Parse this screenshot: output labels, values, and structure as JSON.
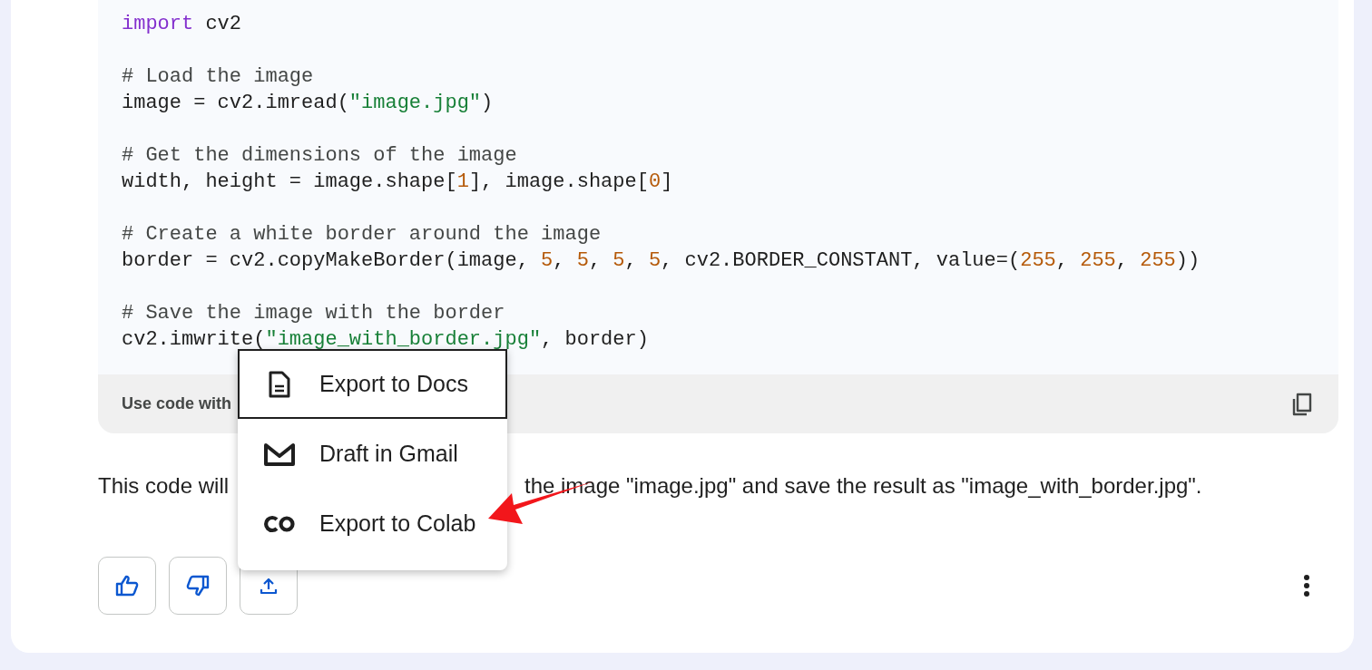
{
  "code_block": {
    "blocks": [
      [
        [
          {
            "kind": "keyword",
            "text": "import"
          },
          {
            "kind": "plain",
            "text": " cv2"
          }
        ]
      ],
      [
        [
          {
            "kind": "comment",
            "text": "# Load the image"
          }
        ],
        [
          {
            "kind": "plain",
            "text": "image = cv2.imread("
          },
          {
            "kind": "string",
            "text": "\"image.jpg\""
          },
          {
            "kind": "plain",
            "text": ")"
          }
        ]
      ],
      [
        [
          {
            "kind": "comment",
            "text": "# Get the dimensions of the image"
          }
        ],
        [
          {
            "kind": "plain",
            "text": "width, height = image.shape["
          },
          {
            "kind": "number",
            "text": "1"
          },
          {
            "kind": "plain",
            "text": "], image.shape["
          },
          {
            "kind": "number",
            "text": "0"
          },
          {
            "kind": "plain",
            "text": "]"
          }
        ]
      ],
      [
        [
          {
            "kind": "comment",
            "text": "# Create a white border around the image"
          }
        ],
        [
          {
            "kind": "plain",
            "text": "border = cv2.copyMakeBorder(image, "
          },
          {
            "kind": "number",
            "text": "5"
          },
          {
            "kind": "plain",
            "text": ", "
          },
          {
            "kind": "number",
            "text": "5"
          },
          {
            "kind": "plain",
            "text": ", "
          },
          {
            "kind": "number",
            "text": "5"
          },
          {
            "kind": "plain",
            "text": ", "
          },
          {
            "kind": "number",
            "text": "5"
          },
          {
            "kind": "plain",
            "text": ", cv2.BORDER_CONSTANT, value=("
          },
          {
            "kind": "number",
            "text": "255"
          },
          {
            "kind": "plain",
            "text": ", "
          },
          {
            "kind": "number",
            "text": "255"
          },
          {
            "kind": "plain",
            "text": ", "
          },
          {
            "kind": "number",
            "text": "255"
          },
          {
            "kind": "plain",
            "text": "))"
          }
        ]
      ],
      [
        [
          {
            "kind": "comment",
            "text": "# Save the image with the border"
          }
        ],
        [
          {
            "kind": "plain",
            "text": "cv2.imwrite("
          },
          {
            "kind": "string",
            "text": "\"image_with_border.jpg\""
          },
          {
            "kind": "plain",
            "text": ", border)"
          }
        ]
      ]
    ],
    "footer_label": "Use code with"
  },
  "response_text": [
    "This code will",
    "the image \"image.jpg\" and save the result as \"image_with_border.jpg\"."
  ],
  "export_menu": [
    {
      "label": "Export to Docs",
      "kind": "doc",
      "selected": true
    },
    {
      "label": "Draft in Gmail",
      "kind": "mail",
      "selected": false
    },
    {
      "label": "Export to Colab",
      "kind": "colab",
      "selected": false
    }
  ],
  "feedback_buttons": [
    {
      "kind": "like"
    },
    {
      "kind": "dislike"
    },
    {
      "kind": "share"
    }
  ]
}
